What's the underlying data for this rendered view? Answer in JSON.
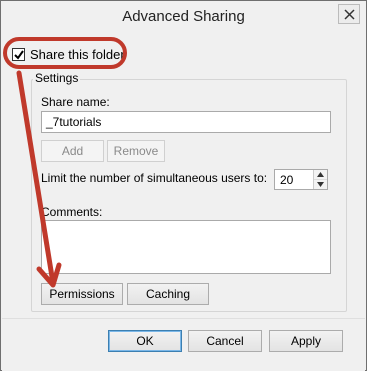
{
  "window": {
    "title": "Advanced Sharing"
  },
  "share": {
    "checkbox_label": "Share this folder",
    "checked": true
  },
  "settings": {
    "legend": "Settings",
    "share_name_label": "Share name:",
    "share_name_value": "_7tutorials",
    "add_label": "Add",
    "remove_label": "Remove",
    "limit_label": "Limit the number of simultaneous users to:",
    "limit_value": "20",
    "comments_label": "Comments:",
    "comments_value": ""
  },
  "actions": {
    "permissions_label": "Permissions",
    "caching_label": "Caching"
  },
  "footer": {
    "ok_label": "OK",
    "cancel_label": "Cancel",
    "apply_label": "Apply"
  },
  "colors": {
    "annotation": "#c0392b",
    "window_bg": "#f0f0f0"
  }
}
